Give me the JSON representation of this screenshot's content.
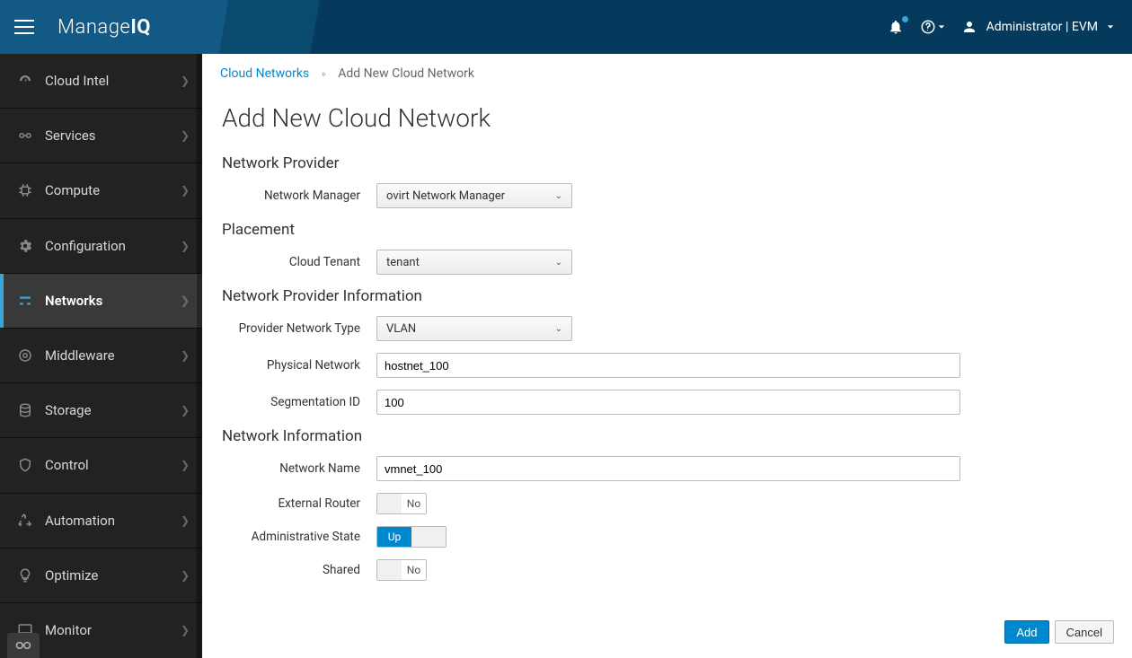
{
  "app_name_light": "Manage",
  "app_name_bold": "IQ",
  "user": {
    "display": "Administrator | EVM"
  },
  "sidebar": {
    "items": [
      {
        "label": "Cloud Intel"
      },
      {
        "label": "Services"
      },
      {
        "label": "Compute"
      },
      {
        "label": "Configuration"
      },
      {
        "label": "Networks"
      },
      {
        "label": "Middleware"
      },
      {
        "label": "Storage"
      },
      {
        "label": "Control"
      },
      {
        "label": "Automation"
      },
      {
        "label": "Optimize"
      },
      {
        "label": "Monitor"
      }
    ]
  },
  "breadcrumb": {
    "parent": "Cloud Networks",
    "current": "Add New Cloud Network"
  },
  "page_title": "Add New Cloud Network",
  "sections": {
    "network_provider": "Network Provider",
    "placement": "Placement",
    "provider_info": "Network Provider Information",
    "network_info": "Network Information"
  },
  "labels": {
    "network_manager": "Network Manager",
    "cloud_tenant": "Cloud Tenant",
    "provider_network_type": "Provider Network Type",
    "physical_network": "Physical Network",
    "segmentation_id": "Segmentation ID",
    "network_name": "Network Name",
    "external_router": "External Router",
    "admin_state": "Administrative State",
    "shared": "Shared"
  },
  "values": {
    "network_manager": "ovirt Network Manager",
    "cloud_tenant": "tenant",
    "provider_network_type": "VLAN",
    "physical_network": "hostnet_100",
    "segmentation_id": "100",
    "network_name": "vmnet_100",
    "external_router_label": "No",
    "admin_state_label": "Up",
    "shared_label": "No"
  },
  "buttons": {
    "add": "Add",
    "cancel": "Cancel"
  }
}
